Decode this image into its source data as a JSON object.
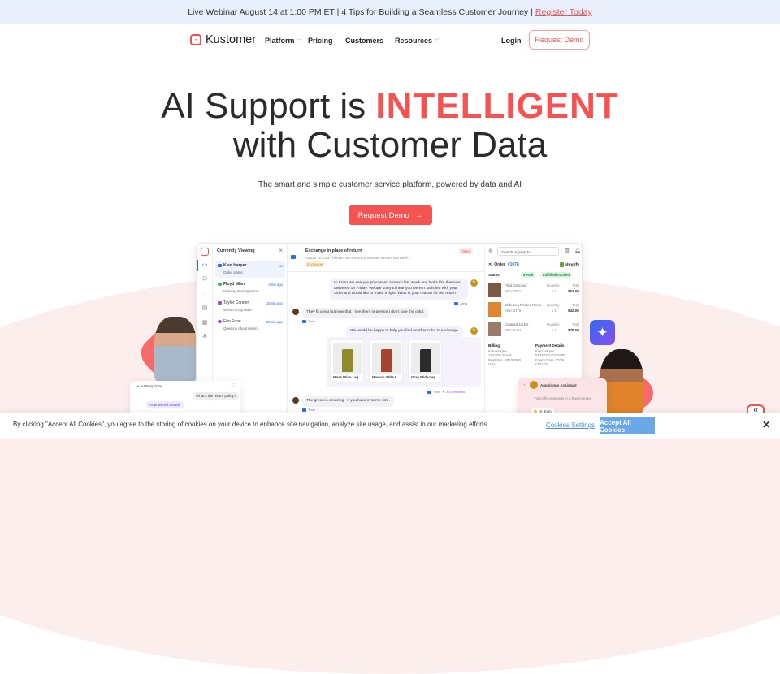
{
  "banner": {
    "text": "Live Webinar August 14 at 1:00 PM ET | 4 Tips for Building a Seamless Customer Journey |",
    "link": "Register Today"
  },
  "nav": {
    "brand": "Kustomer",
    "items": [
      {
        "label": "Platform",
        "has_dropdown": true
      },
      {
        "label": "Pricing",
        "has_dropdown": false
      },
      {
        "label": "Customers",
        "has_dropdown": false
      },
      {
        "label": "Resources",
        "has_dropdown": true
      }
    ],
    "login": "Login",
    "demo": "Request Demo"
  },
  "hero": {
    "line1_prefix": "AI Support is",
    "line1_accent": "INTELLIGENT",
    "line2": "with Customer Data",
    "subtitle": "The smart and simple customer service platform, powered by data and AI",
    "cta": "Request Demo",
    "cta_icon": "→",
    "accent_color": "#f55252"
  },
  "app": {
    "list": {
      "title": "Currently Viewing",
      "items": [
        {
          "name": "Kian Harper",
          "time": "1w",
          "preview": "Order status",
          "channel": "email",
          "color": "#2b6de8"
        },
        {
          "name": "Floyd Miles",
          "time": "4min ago",
          "preview": "Delivery missing items...",
          "channel": "whatsapp",
          "color": "#25b35a"
        },
        {
          "name": "Taylor Conner",
          "time": "15min ago",
          "preview": "Where is my order?",
          "channel": "chat",
          "color": "#a64ee0"
        },
        {
          "name": "Erin Frost",
          "time": "20min ago",
          "preview": "Question about return...",
          "channel": "messenger",
          "color": "#8a4ef0"
        }
      ]
    },
    "thread": {
      "title": "Exchange in place of return",
      "date": "August 18 2023 • Hi Kian! We see you processed a return last week...",
      "tag": "Exchange",
      "status": "Open",
      "messages": [
        {
          "dir": "out",
          "text": "Hi Kian! We see you processed a return last week and looks like that was delivered on Friday. We are sorry to hear you weren't satisfied with your order and would like to make it right. What is your reason for the return?",
          "meta": "Zenis"
        },
        {
          "dir": "in",
          "text": "They fit great but now that I see them in person I don't love the color.",
          "meta": "Tenin"
        },
        {
          "dir": "out",
          "text": "We would be happy to help you find another color to exchange.",
          "meta": ""
        },
        {
          "dir": "in",
          "text": "The green is amazing - if you have in same size.",
          "meta": "Tenin"
        }
      ],
      "products": [
        {
          "name": "Moss Wide Leg...",
          "color": "#8f8a2c"
        },
        {
          "name": "Maroon Wide L...",
          "color": "#a5452f"
        },
        {
          "name": "Gray Wide Leg...",
          "color": "#2b2b2b"
        }
      ],
      "products_meta": "Tenin",
      "ai_label": "AI Generated"
    },
    "side": {
      "search_placeholder": "Search or jump to...",
      "order_label": "Order",
      "order_number": "#1078",
      "store": "shopify",
      "status_label": "Status",
      "pills": [
        "$ Paid",
        "Fulfilled/Tracked"
      ],
      "items": [
        {
          "name": "Plaid Jumpsuit",
          "sku": "SKU: 2841",
          "qty": "x 1",
          "total": "$63.00",
          "color": "#7a5a44"
        },
        {
          "name": "Wide Leg Pleated Pants",
          "sku": "SKU: 3179",
          "qty": "x 1",
          "total": "$42.00",
          "color": "#e0852e"
        },
        {
          "name": "Cropped Jacket",
          "sku": "SKU: 5362",
          "qty": "x 1",
          "total": "$78.00",
          "color": "#9a7a68"
        }
      ],
      "quantity_label": "Quantity",
      "total_label": "Total",
      "billing": {
        "title": "Billing",
        "lines": [
          "Kian Harper",
          "123 Elm Street",
          "Mapleton, MN 56000",
          "USA"
        ]
      },
      "payment": {
        "title": "Payment Details",
        "lines": [
          "Kian Harper",
          "5123-****-****-8789",
          "Expiry Date: 07/25",
          "CVV: ***"
        ]
      }
    }
  },
  "widget_left": {
    "title": "AI Response",
    "question": "What's the return policy?",
    "answer": "AI-powered answer"
  },
  "widget_right": {
    "title": "Appalogue Assistant",
    "subtitle": "Typically responds in a few minutes.",
    "greeting": "👋 Hi, Kian"
  },
  "cookie": {
    "text": "By clicking \"Accept All Cookies\", you agree to the storing of cookies on your device to enhance site navigation, analyze site usage, and assist in our marketing efforts.",
    "settings": "Cookies Settings",
    "accept": "Accept All Cookies",
    "close": "✕"
  }
}
